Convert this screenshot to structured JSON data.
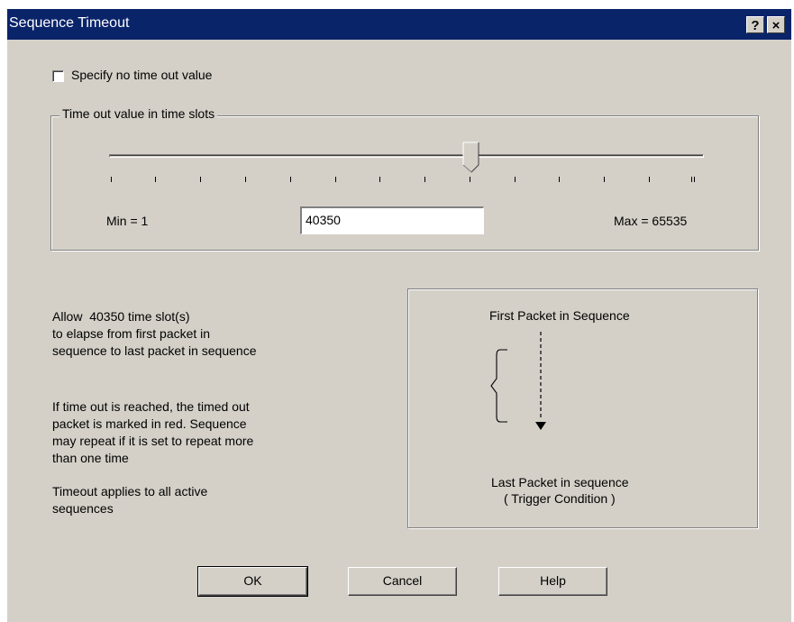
{
  "window": {
    "title": "Sequence Timeout",
    "help_button": "?",
    "close_button": "×"
  },
  "options": {
    "no_timeout_label": "Specify no time out value",
    "no_timeout_checked": false
  },
  "timeout_group": {
    "legend": "Time out value in time slots",
    "min_label": "Min = 1",
    "max_label": "Max = 65535",
    "value": "40350"
  },
  "slider": {
    "min": 1,
    "max": 65535,
    "value": 40350
  },
  "description": {
    "allow_text": "Allow  40350 time slot(s)\nto elapse from first packet in\nsequence to last packet in sequence",
    "timeout_text": "If time out is reached, the timed out\npacket is marked in red. Sequence\nmay repeat if it is set to repeat more\nthan one time",
    "applies_text": "Timeout applies to all active\nsequences"
  },
  "diagram": {
    "first_label": "First Packet in Sequence",
    "last_label": "Last Packet in sequence",
    "trigger_label": "( Trigger Condition )"
  },
  "buttons": {
    "ok": "OK",
    "cancel": "Cancel",
    "help": "Help"
  }
}
